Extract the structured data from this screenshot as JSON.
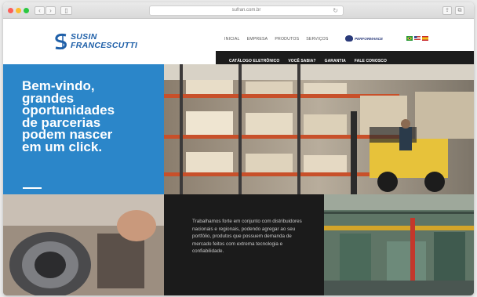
{
  "browser": {
    "url": "sufran.com.br",
    "reload_icon": "reload-icon",
    "back_icon": "chevron-left-icon",
    "forward_icon": "chevron-right-icon"
  },
  "brand": {
    "line1": "SUSIN",
    "line2": "FRANCESCUTTI",
    "color": "#1e5fa8"
  },
  "nav": {
    "items": [
      "INICIAL",
      "EMPRESA",
      "PRODUTOS",
      "SERVIÇOS"
    ],
    "performance": "PERFORMANCE"
  },
  "flags": [
    "brazil-flag-icon",
    "usa-flag-icon",
    "spain-flag-icon"
  ],
  "subnav": {
    "items": [
      "CATÁLOGO ELETRÔNICO",
      "VOCÊ SABIA?",
      "GARANTIA",
      "FALE CONOSCO"
    ]
  },
  "hero": {
    "line1": "Bem-vindo,",
    "line2": "grandes",
    "line3": "oportunidades",
    "line4": "de parcerias",
    "line5": "podem nascer",
    "line6": "em um click.",
    "accent": "#2b86c9"
  },
  "about": {
    "text": "Trabalhamos forte em conjunto com distribuidores nacionais e regionais, podendo agregar ao seu portfólio, produtos que possuem demanda de mercado feitos com extrema tecnologia e confiabilidade."
  }
}
